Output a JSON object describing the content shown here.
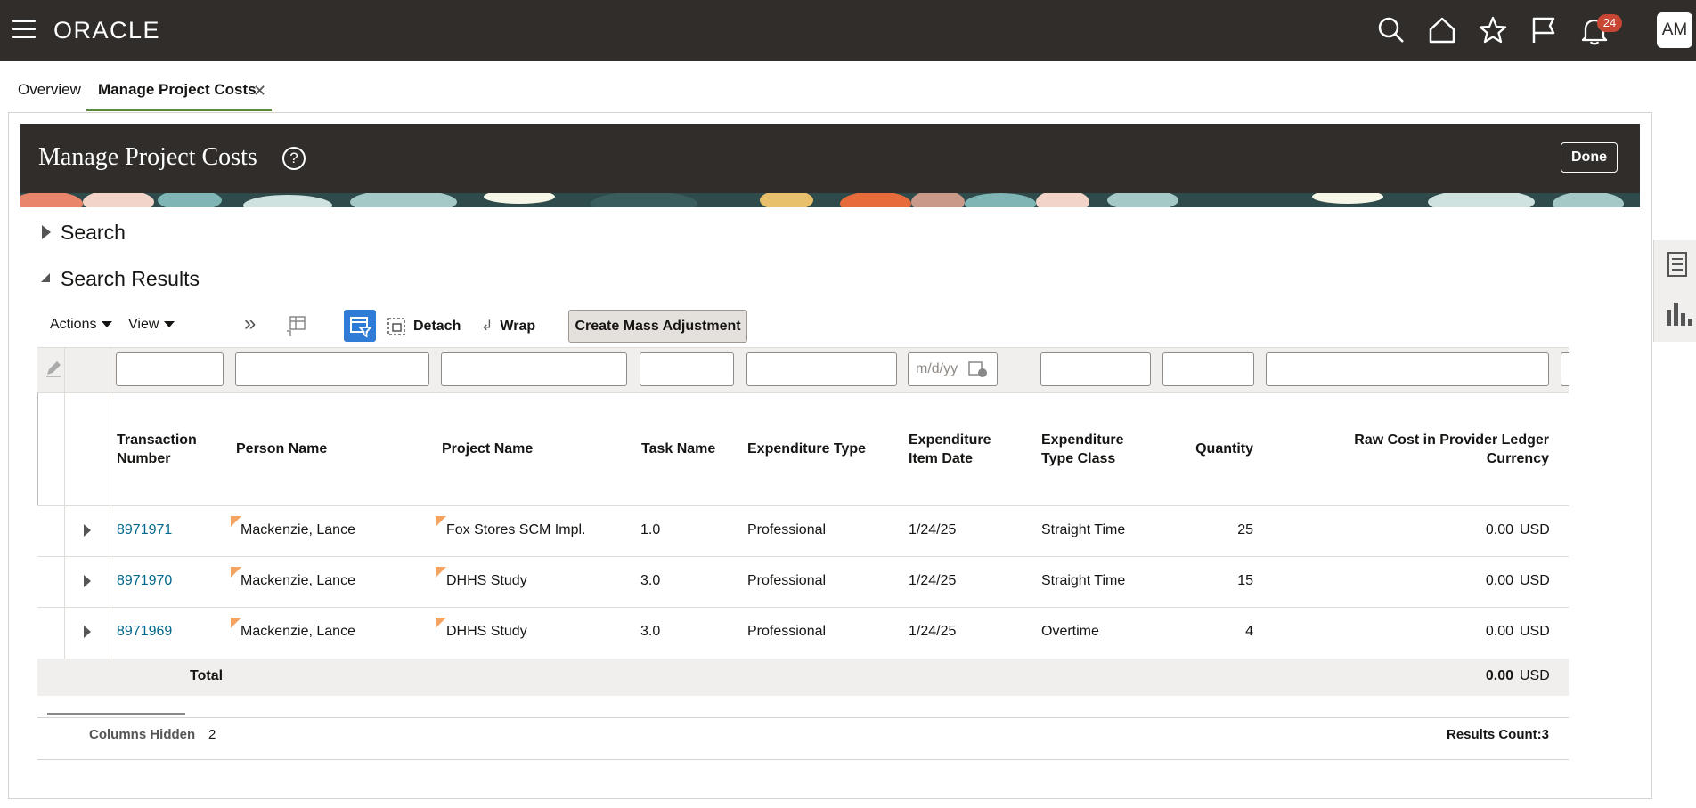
{
  "header": {
    "logo": "ORACLE",
    "notification_count": "24",
    "avatar_initials": "AM",
    "icons": [
      "hamburger-icon",
      "search-icon",
      "home-icon",
      "star-icon",
      "flag-icon",
      "bell-icon"
    ]
  },
  "tabs": [
    {
      "label": "Overview",
      "active": false
    },
    {
      "label": "Manage Project Costs",
      "active": true,
      "closable": true
    }
  ],
  "page": {
    "title": "Manage Project Costs",
    "help_icon": "?",
    "done_label": "Done"
  },
  "sections": {
    "search_label": "Search",
    "search_expanded": false,
    "results_label": "Search Results",
    "results_expanded": true
  },
  "toolbar": {
    "actions_label": "Actions",
    "view_label": "View",
    "detach_label": "Detach",
    "wrap_label": "Wrap",
    "mass_adjust_label": "Create Mass Adjustment"
  },
  "filters": {
    "date_placeholder": "m/d/yy"
  },
  "table": {
    "columns": {
      "transaction_number_1": "Transaction",
      "transaction_number_2": "Number",
      "person_name": "Person Name",
      "project_name": "Project Name",
      "task_name": "Task Name",
      "expenditure_type": "Expenditure Type",
      "expenditure_item_date_1": "Expenditure",
      "expenditure_item_date_2": "Item Date",
      "expenditure_type_class_1": "Expenditure",
      "expenditure_type_class_2": "Type Class",
      "quantity": "Quantity",
      "raw_cost_1": "Raw Cost in Provider Ledger",
      "raw_cost_2": "Currency"
    },
    "rows": [
      {
        "transaction": "8971971",
        "person": "Mackenzie, Lance",
        "project": "Fox Stores SCM Impl.",
        "task": "1.0",
        "exp_type": "Professional",
        "date": "1/24/25",
        "type_class": "Straight Time",
        "quantity": "25",
        "raw_cost": "0.00",
        "currency": "USD"
      },
      {
        "transaction": "8971970",
        "person": "Mackenzie, Lance",
        "project": "DHHS Study",
        "task": "3.0",
        "exp_type": "Professional",
        "date": "1/24/25",
        "type_class": "Straight Time",
        "quantity": "15",
        "raw_cost": "0.00",
        "currency": "USD"
      },
      {
        "transaction": "8971969",
        "person": "Mackenzie, Lance",
        "project": "DHHS Study",
        "task": "3.0",
        "exp_type": "Professional",
        "date": "1/24/25",
        "type_class": "Overtime",
        "quantity": "4",
        "raw_cost": "0.00",
        "currency": "USD"
      }
    ],
    "total_label": "Total",
    "total_value": "0.00",
    "total_currency": "USD"
  },
  "footer": {
    "columns_hidden_label": "Columns Hidden",
    "columns_hidden_count": "2",
    "results_count": "Results Count:3"
  },
  "colors": {
    "header_bg": "#312d2a",
    "link": "#00688c",
    "badge": "#c74634",
    "active_tab_underline": "#5b8a3c",
    "filter_button": "#2e7cd6"
  }
}
